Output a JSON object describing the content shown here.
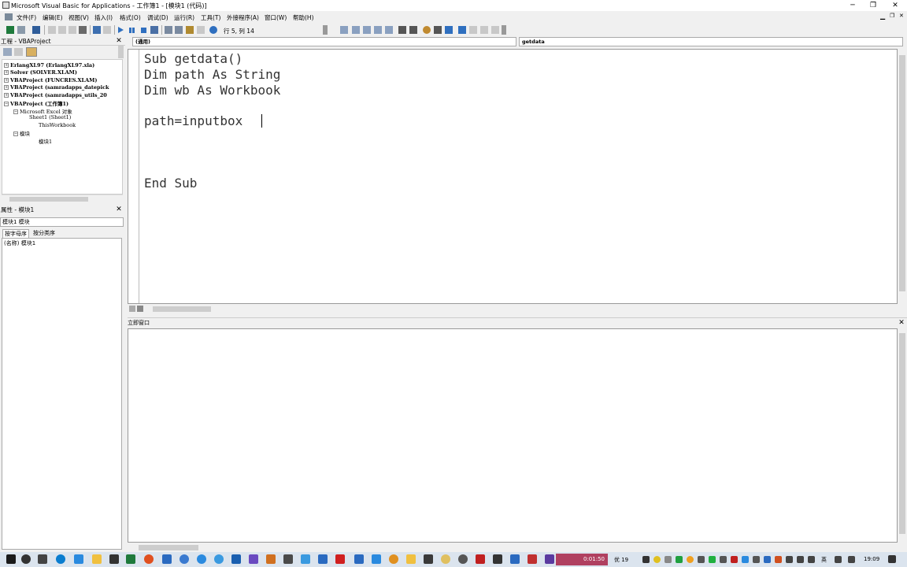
{
  "window": {
    "title": "Microsoft Visual Basic for Applications - 工作簿1 - [模块1 (代码)]",
    "minimize": "─",
    "restore": "❐",
    "close": "✕",
    "doc_min": "▁",
    "doc_restore": "❐",
    "doc_close": "✕"
  },
  "menu": [
    "文件(F)",
    "编辑(E)",
    "视图(V)",
    "插入(I)",
    "格式(O)",
    "调试(D)",
    "运行(R)",
    "工具(T)",
    "外接程序(A)",
    "窗口(W)",
    "帮助(H)"
  ],
  "toolbar": {
    "position": "行 5, 列 14"
  },
  "project": {
    "title": "工程 - VBAProject",
    "nodes": [
      {
        "label": "ErlangXL97 (ErlangXL97.xla)",
        "bold": true
      },
      {
        "label": "Solver (SOLVER.XLAM)",
        "bold": true
      },
      {
        "label": "VBAProject (FUNCRES.XLAM)",
        "bold": true
      },
      {
        "label": "VBAProject (samradapps_datepick",
        "bold": true
      },
      {
        "label": "VBAProject (samradapps_utils_20",
        "bold": true
      },
      {
        "label": "VBAProject (工作簿1)",
        "bold": true
      },
      {
        "label": "Microsoft Excel 对象",
        "bold": false
      },
      {
        "label": "Sheet1 (Sheet1)",
        "bold": false
      },
      {
        "label": "ThisWorkbook",
        "bold": false
      },
      {
        "label": "模块",
        "bold": false
      },
      {
        "label": "模块1",
        "bold": false
      }
    ]
  },
  "properties": {
    "title": "属性 - 模块1",
    "selected": "模块1 模块",
    "tab_alpha": "按字母序",
    "tab_category": "按分类序",
    "row_name": "(名称)",
    "row_value": "模块1"
  },
  "code": {
    "object_combo": "(通用)",
    "proc_combo": "getdata",
    "lines": [
      "Sub getdata()",
      "Dim path As String",
      "Dim wb As Workbook",
      "",
      "path=inputbox",
      "",
      "",
      "",
      "End Sub"
    ]
  },
  "immediate": {
    "title": "立即窗口"
  },
  "taskbar": {
    "timer": "0:01:50",
    "weather": "优 19",
    "ime": "英",
    "clock": "19:09"
  }
}
